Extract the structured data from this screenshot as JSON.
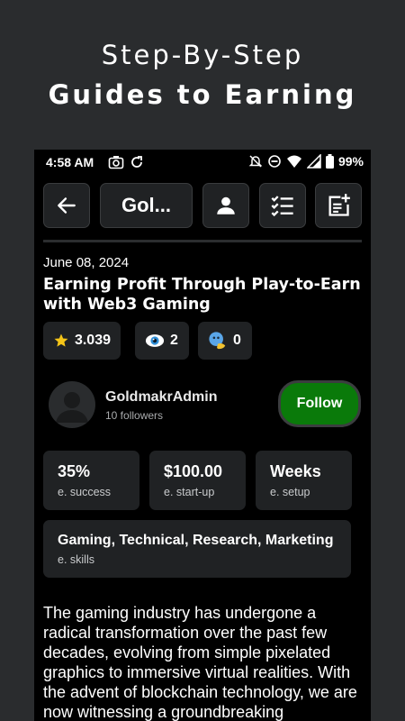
{
  "promo": {
    "line1": "Step-By-Step",
    "line2": "Guides to Earning"
  },
  "status_bar": {
    "time": "4:58 AM",
    "battery": "99%"
  },
  "toolbar": {
    "title": "Gol...",
    "icons": [
      "back-arrow-icon",
      "person-icon",
      "checklist-icon",
      "note-add-icon"
    ]
  },
  "article": {
    "date": "June 08, 2024",
    "title": "Earning Profit Through Play-to-Earn with Web3 Gaming",
    "rating": "3.039",
    "views": "2",
    "comments": "0",
    "body": "The gaming industry has undergone a radical transformation over the past few decades, evolving from simple pixelated graphics to immersive virtual realities. With the advent of blockchain technology, we are now witnessing a groundbreaking"
  },
  "author": {
    "name": "GoldmakrAdmin",
    "followers": "10 followers",
    "follow_label": "Follow"
  },
  "stats": [
    {
      "value": "35%",
      "label": "e. success"
    },
    {
      "value": "$100.00",
      "label": "e. start-up"
    },
    {
      "value": "Weeks",
      "label": "e. setup"
    }
  ],
  "skills": {
    "value": "Gaming, Technical, Research, Marketing",
    "label": "e. skills"
  },
  "colors": {
    "follow_button": "#0a7a0a",
    "card_bg": "#202224",
    "page_bg": "#2a2c2e"
  }
}
